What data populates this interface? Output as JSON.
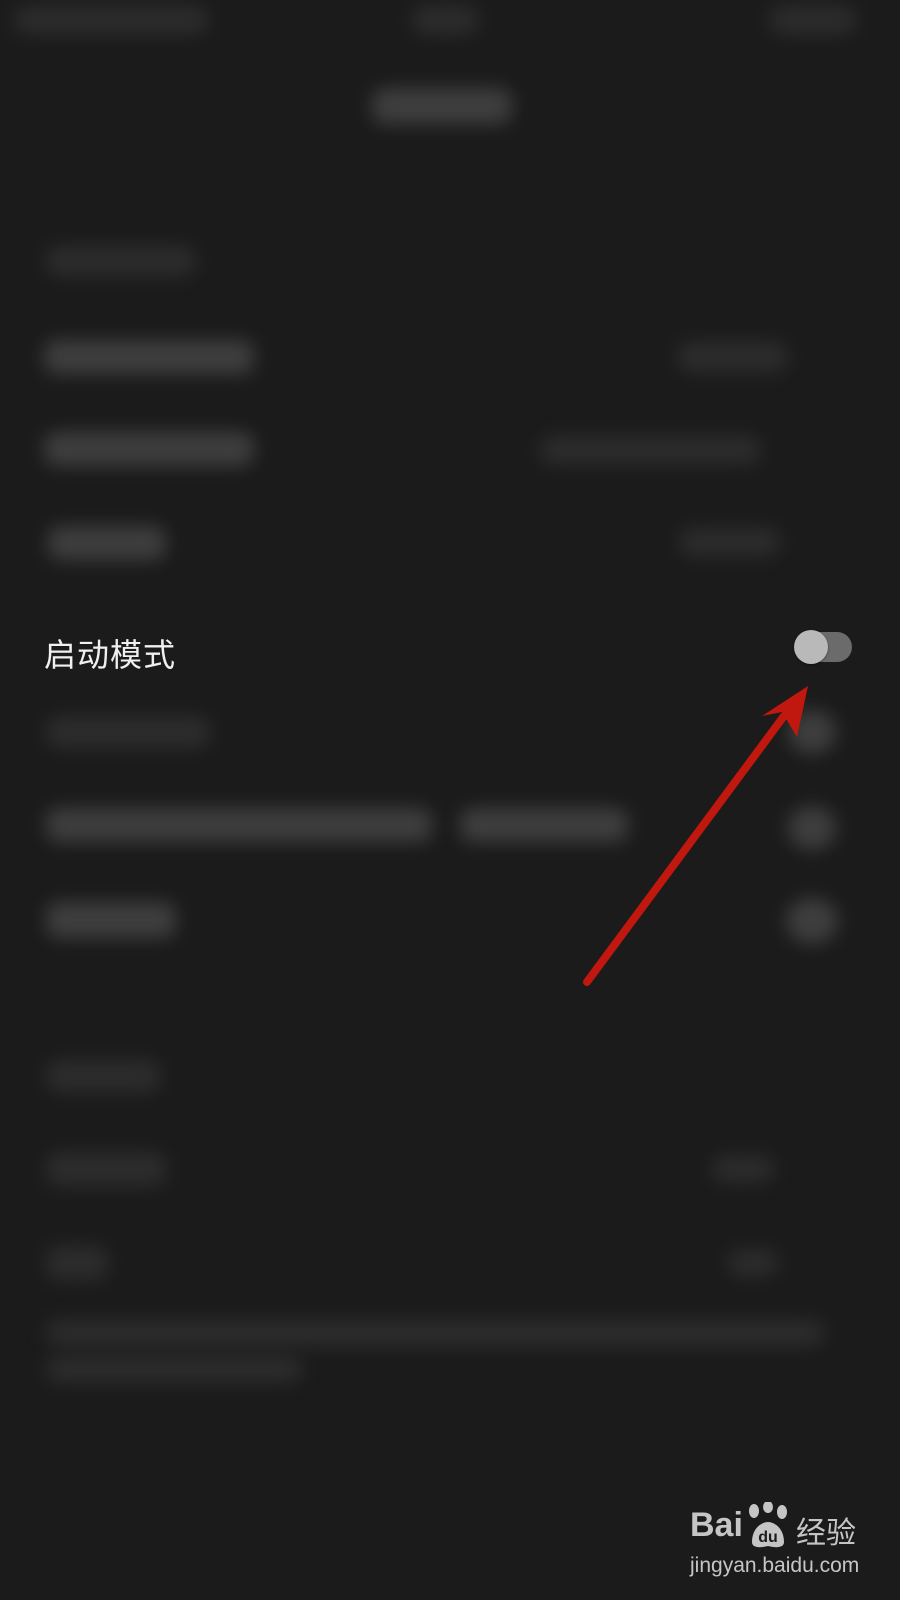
{
  "setting_row": {
    "label": "启动模式",
    "toggle_on": false
  },
  "annotation": {
    "arrow_color": "#c0170f",
    "points_to": "mode-toggle"
  },
  "watermark": {
    "brand_left": "Bai",
    "brand_right": "经验",
    "url": "jingyan.baidu.com"
  },
  "colors": {
    "background": "#1b1b1b",
    "toggle_track": "#6b6b6b",
    "toggle_knob": "#b9b9b9",
    "label_text": "#f0f0f0"
  }
}
